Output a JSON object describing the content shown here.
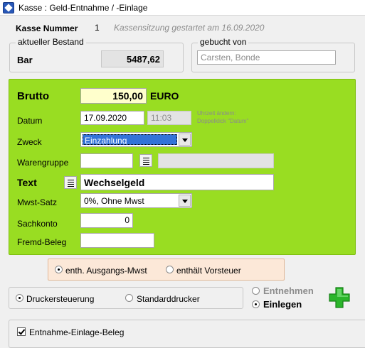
{
  "window": {
    "title": "Kasse : Geld-Entnahme / -Einlage"
  },
  "header": {
    "kasse_label": "Kasse Nummer",
    "kasse_number": "1",
    "session_text": "Kassensitzung gestartet am 16.09.2020"
  },
  "bestand": {
    "group_label": "aktueller Bestand",
    "label": "Bar",
    "value": "5487,62"
  },
  "gebucht": {
    "group_label": "gebucht von",
    "value": "Carsten, Bonde"
  },
  "form": {
    "brutto_label": "Brutto",
    "brutto_value": "150,00",
    "currency": "EURO",
    "datum_label": "Datum",
    "datum_value": "17.09.2020",
    "time_value": "11:03",
    "time_hint_1": "Uhrzeit ändern:",
    "time_hint_2": "Doppelklick \"Datum\"",
    "zweck_label": "Zweck",
    "zweck_value": "Einzahlung",
    "warengruppe_label": "Warengruppe",
    "warengruppe_value": "",
    "warengruppe_desc": "",
    "text_label": "Text",
    "text_value": "Wechselgeld",
    "mwst_label": "Mwst-Satz",
    "mwst_value": "0%, Ohne Mwst",
    "sachkonto_label": "Sachkonto",
    "sachkonto_value": "0",
    "fremd_label": "Fremd-Beleg",
    "fremd_value": ""
  },
  "mwst_radio": {
    "option1": "enth. Ausgangs-Mwst",
    "option2": "enthält Vorsteuer",
    "selected": "option1"
  },
  "drucker": {
    "option1": "Druckersteuerung",
    "option2": "Standarddrucker",
    "selected": "option1"
  },
  "mode": {
    "option1": "Entnehmen",
    "option2": "Einlegen",
    "selected": "option2"
  },
  "beleg": {
    "label": "Entnahme-Einlage-Beleg",
    "checked": true
  },
  "colors": {
    "form_background": "#99dd22",
    "brutto_field": "#ffffcc",
    "radio_panel": "#fce8d8",
    "plus_icon": "#2bb52b",
    "selection": "#3373d8"
  }
}
